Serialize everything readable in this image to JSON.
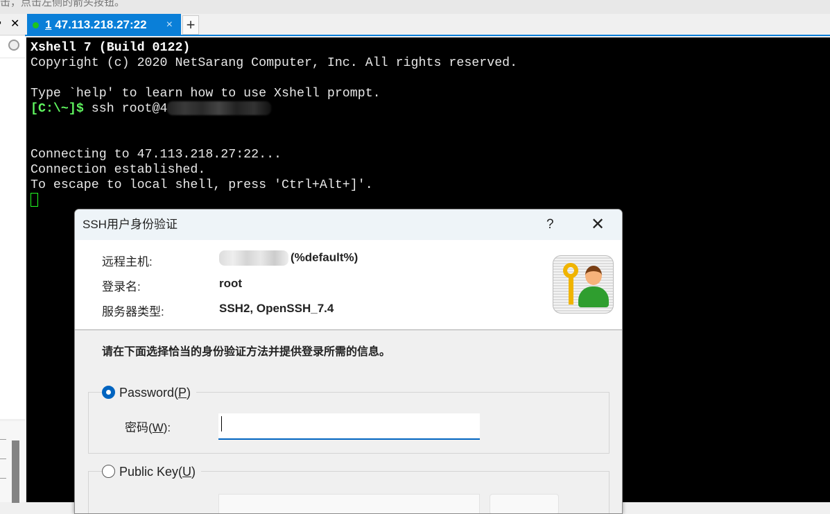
{
  "top_hint": "击，点击左侧的箭头按钮。",
  "left_panel": {
    "pin_icon": "pin-icon",
    "close_label": "✕",
    "search_icon": "search-icon"
  },
  "tabs": [
    {
      "number": "1",
      "label": "47.113.218.27:22",
      "status_color": "#1ec41e",
      "close": "×"
    }
  ],
  "new_tab_label": "+",
  "terminal": {
    "lines": [
      "Xshell 7 (Build 0122)",
      "Copyright (c) 2020 NetSarang Computer, Inc. All rights reserved.",
      "",
      "Type `help' to learn how to use Xshell prompt."
    ],
    "prompt": "[C:\\~]$",
    "command": " ssh root@4",
    "output": [
      "Connecting to 47.113.218.27:22...",
      "Connection established.",
      "To escape to local shell, press 'Ctrl+Alt+]'."
    ]
  },
  "dialog": {
    "title": "SSH用户身份验证",
    "help": "?",
    "close": "✕",
    "remote_host_label": "远程主机:",
    "remote_host_value": "(%default%)",
    "login_label": "登录名:",
    "login_value": "root",
    "server_type_label": "服务器类型:",
    "server_type_value": "SSH2, OpenSSH_7.4",
    "instruction": "请在下面选择恰当的身份验证方法并提供登录所需的信息。",
    "password_option": {
      "label": "Password(",
      "key": "P",
      "end": ")",
      "selected": true
    },
    "password_field_label": {
      "label": "密码(",
      "key": "W",
      "end": "):"
    },
    "password_value": "",
    "public_key_option": {
      "label": "Public Key(",
      "key": "U",
      "end": ")",
      "selected": false
    }
  }
}
